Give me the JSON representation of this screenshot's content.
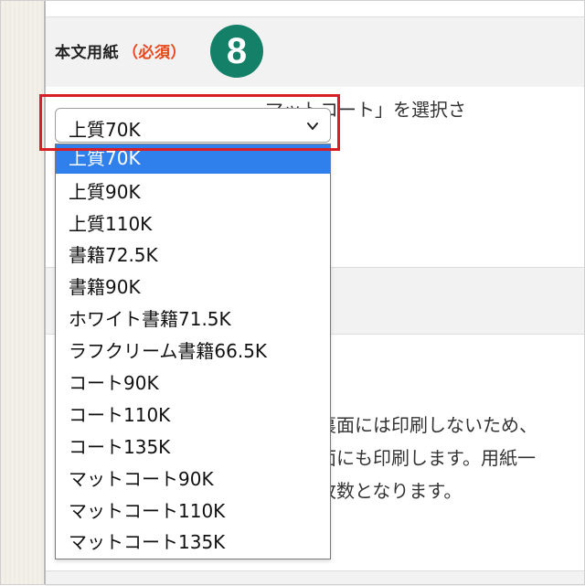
{
  "section": {
    "title": "本文用紙",
    "required": "（必須）",
    "step_number": "8"
  },
  "select": {
    "current_value": "上質70K",
    "icon": "chevron-down-icon"
  },
  "dropdown": {
    "options": [
      "上質70K",
      "上質90K",
      "上質110K",
      "書籍72.5K",
      "書籍90K",
      "ホワイト書籍71.5K",
      "ラフクリーム書籍66.5K",
      "コート90K",
      "コート110K",
      "コート135K",
      "マットコート90K",
      "マットコート110K",
      "マットコート135K"
    ],
    "selected_index": 0
  },
  "background_text": {
    "partial_line": "マットコート」を選択さ",
    "notes": [
      "裏面には印刷しないため、",
      "面にも印刷します。用紙一",
      "枚数となります。"
    ]
  },
  "colors": {
    "accent_badge": "#148067",
    "required_text": "#e8471b",
    "highlight_border": "#d81f26",
    "selected_option": "#2f80ed"
  }
}
